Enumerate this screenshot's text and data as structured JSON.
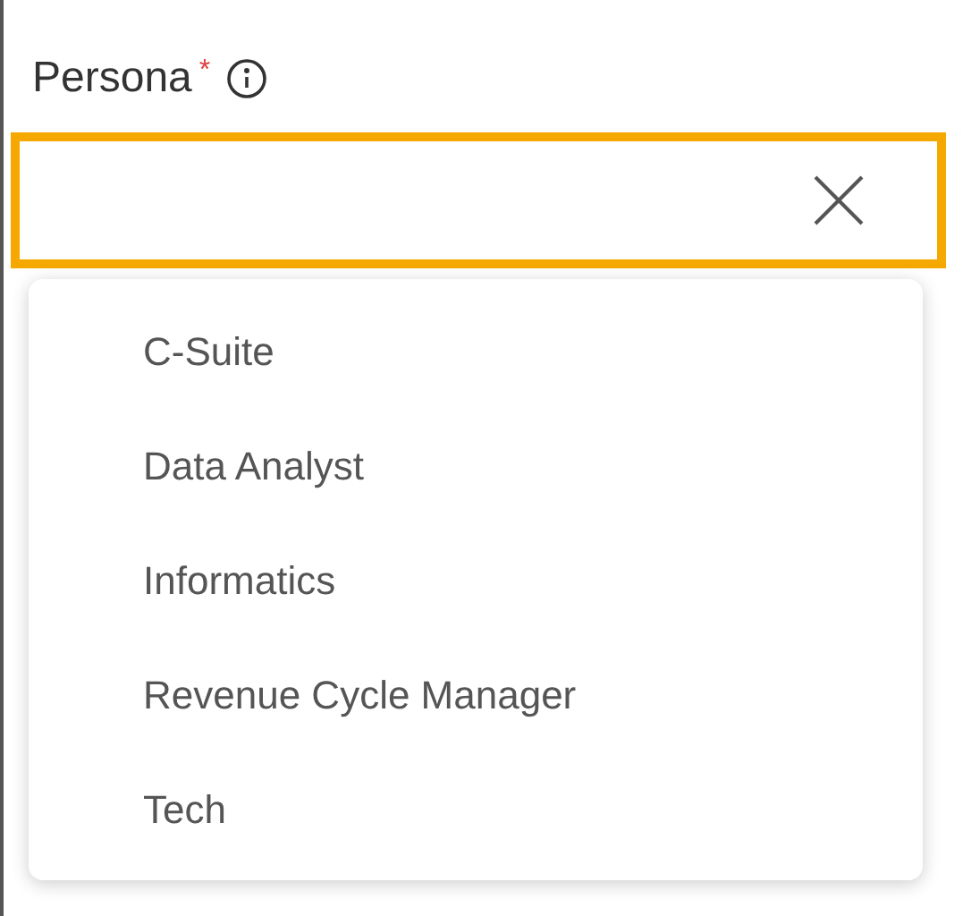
{
  "field": {
    "label": "Persona",
    "required_mark": "*"
  },
  "options": [
    {
      "label": "C-Suite"
    },
    {
      "label": "Data Analyst"
    },
    {
      "label": "Informatics"
    },
    {
      "label": "Revenue Cycle Manager"
    },
    {
      "label": "Tech"
    }
  ]
}
